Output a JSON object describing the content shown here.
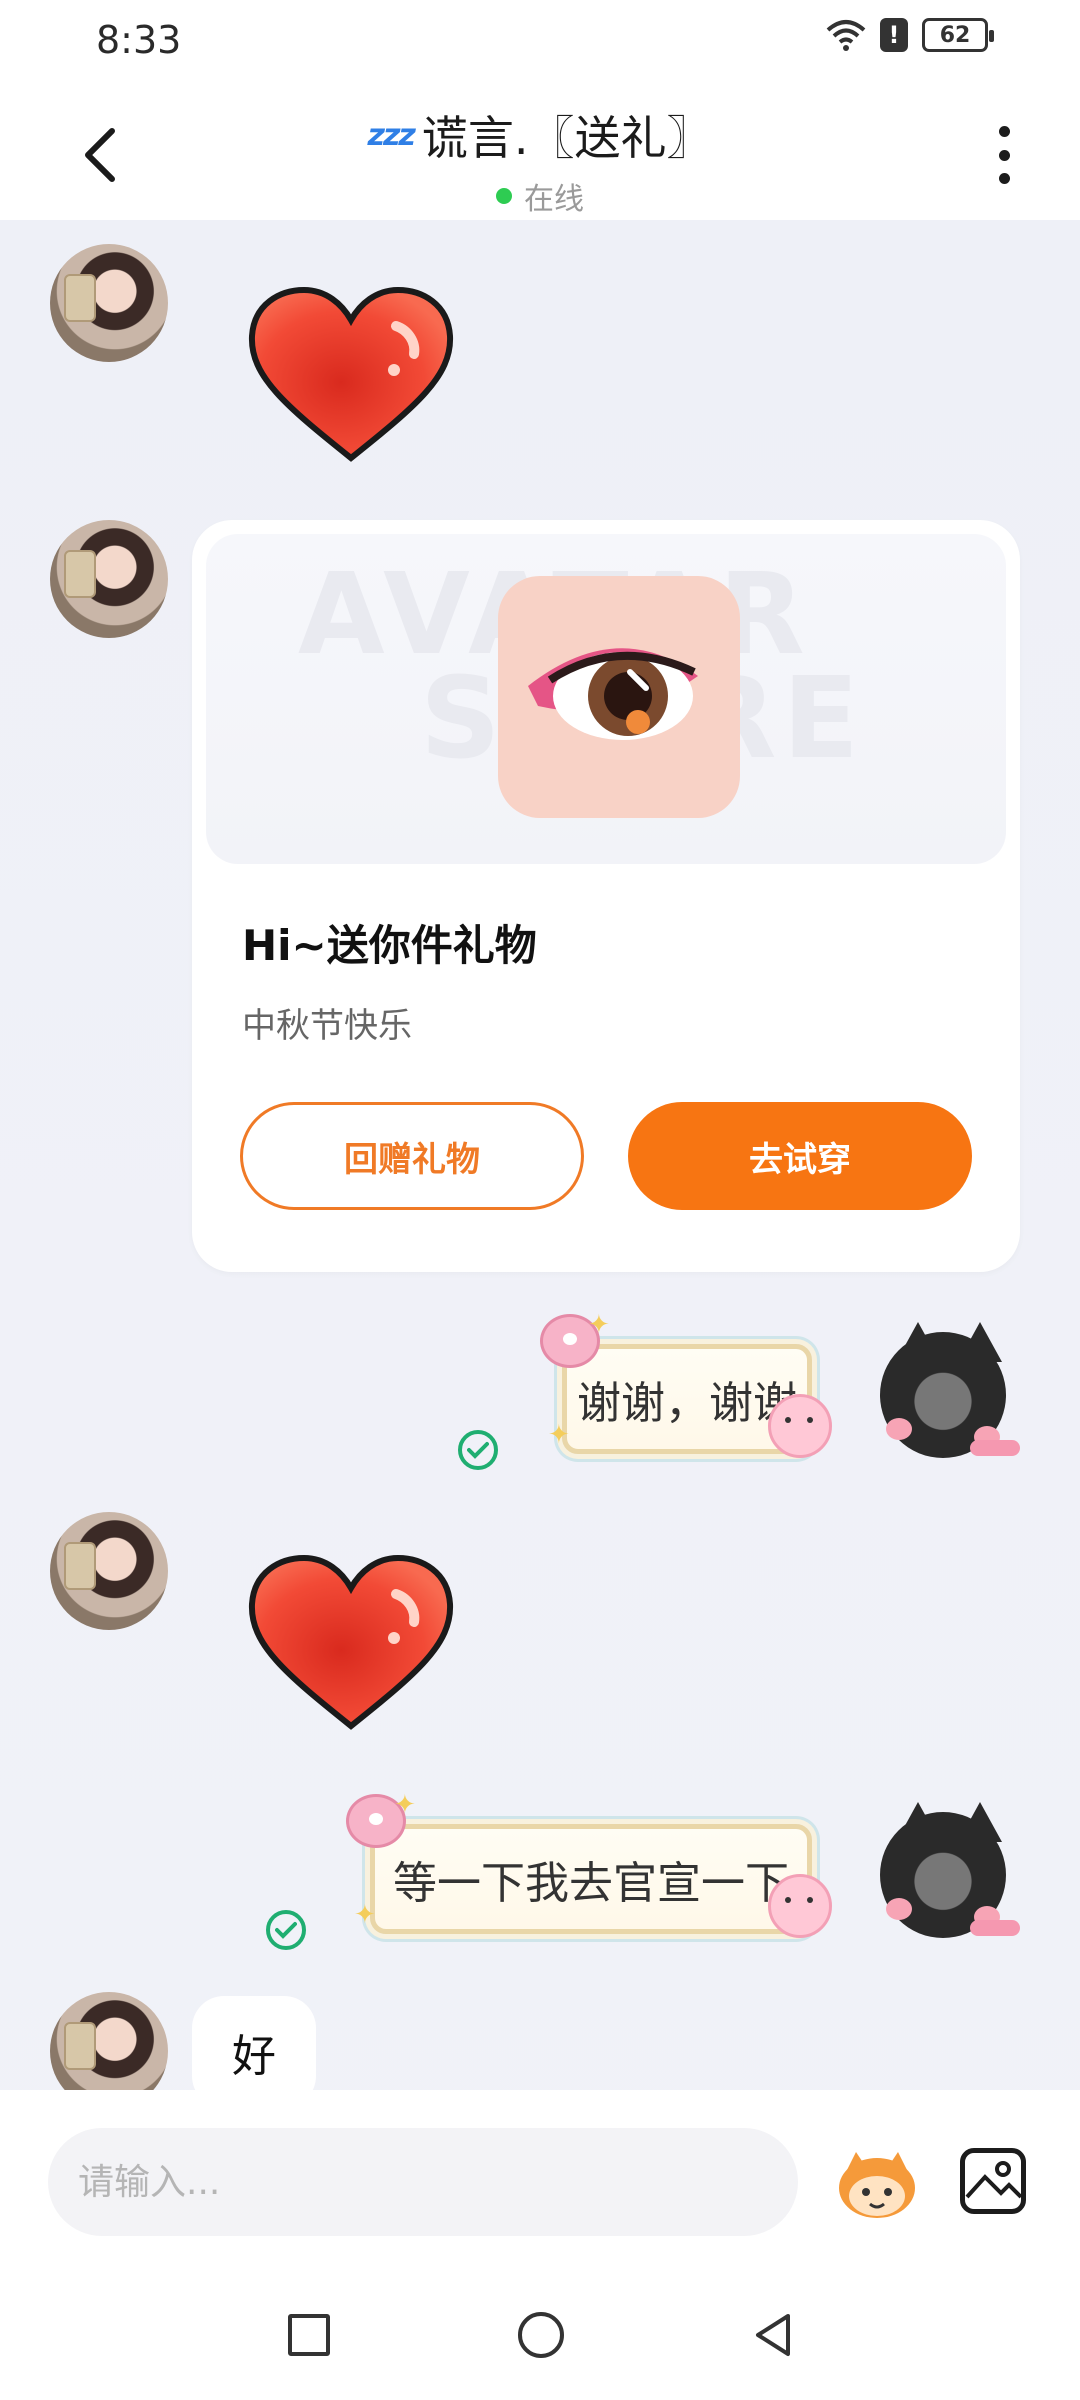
{
  "status_bar": {
    "time": "8:33",
    "battery": "62"
  },
  "header": {
    "title_emoji": "zzz",
    "title": "谎言.〖送礼〗",
    "online_label": "在线"
  },
  "gift_card": {
    "title": "Hi~送你件礼物",
    "subtitle": "中秋节快乐",
    "return_gift_label": "回赠礼物",
    "try_on_label": "去试穿",
    "watermark_line1": "AVATAR",
    "watermark_line2": "STORE"
  },
  "messages": {
    "thanks": "谢谢，谢谢",
    "announce": "等一下我去官宣一下",
    "reply_ok": "好"
  },
  "input": {
    "placeholder": "请输入..."
  },
  "colors": {
    "accent": "#f77512",
    "online": "#2ecc52",
    "read_check": "#1fae71"
  },
  "icons": {
    "back": "chevron-left-icon",
    "more": "more-vertical-icon",
    "mascot": "mascot-emoji-icon",
    "image": "image-icon",
    "nav_recent": "square-icon",
    "nav_home": "circle-icon",
    "nav_back": "triangle-back-icon"
  }
}
